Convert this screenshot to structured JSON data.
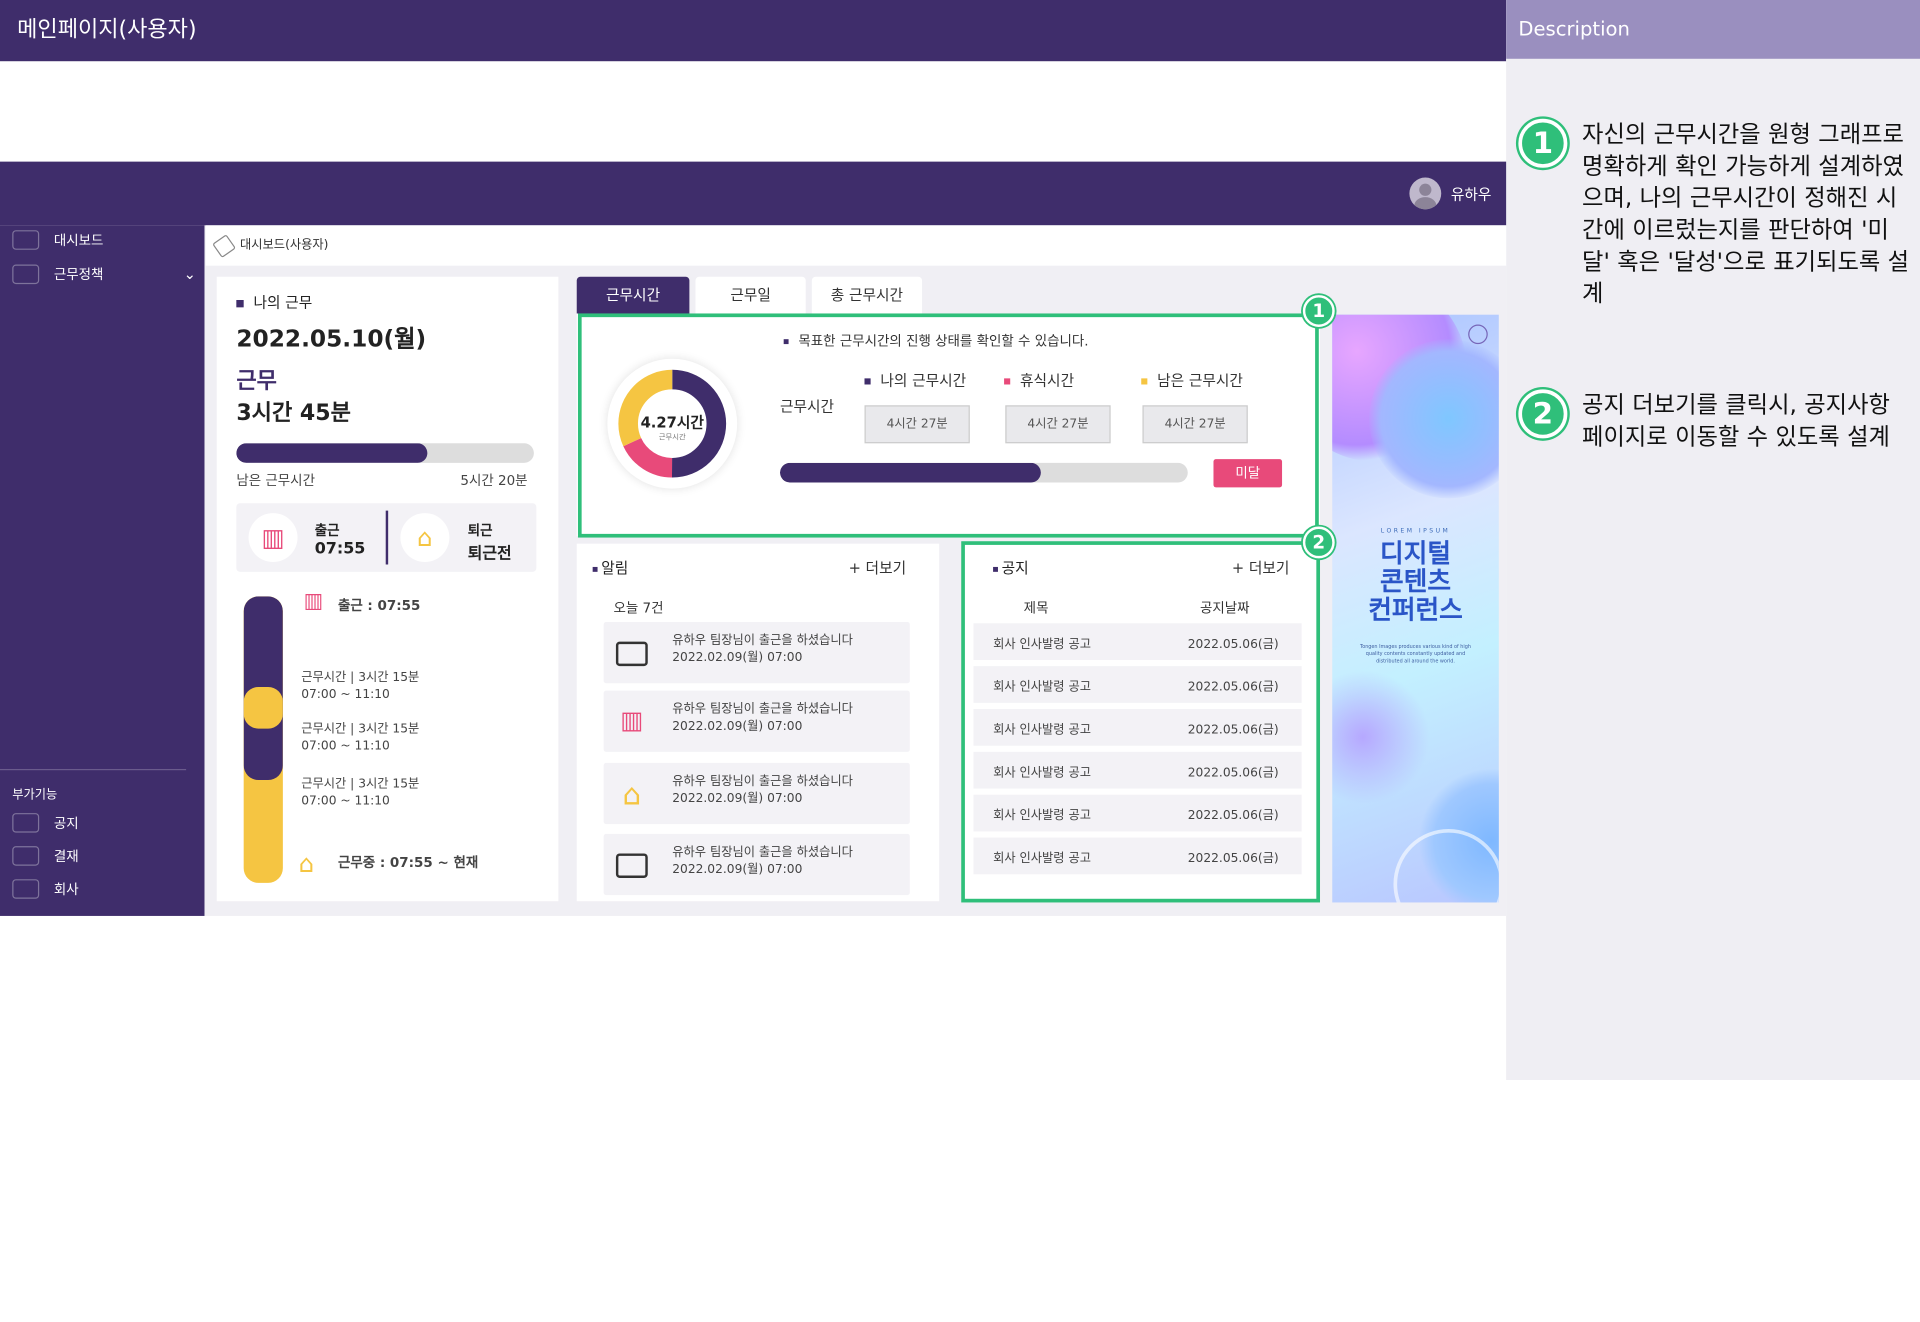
{
  "page_title": "메인페이지(사용자)",
  "description": {
    "heading": "Description",
    "items": [
      {
        "num": "1",
        "text": "자신의 근무시간을 원형 그래프로 명확하게 확인 가능하게 설계하였으며, 나의 근무시간이 정해진 시간에 이르렀는지를 판단하여 '미달' 혹은 '달성'으로 표기되도록 설계"
      },
      {
        "num": "2",
        "text": "공지 더보기를 클릭시, 공지사항 페이지로 이동할 수 있도록 설계"
      }
    ]
  },
  "header": {
    "user_name": "유하우"
  },
  "sidebar": {
    "items": [
      {
        "label": "대시보드",
        "icon": "pencil-icon"
      },
      {
        "label": "근무정책",
        "icon": "chart-icon",
        "chevron": "⌄"
      }
    ],
    "sub_heading": "부가기능",
    "sub_items": [
      {
        "label": "공지",
        "icon": "megaphone-icon"
      },
      {
        "label": "결재",
        "icon": "clipboard-icon"
      },
      {
        "label": "회사",
        "icon": "building-icon"
      }
    ]
  },
  "breadcrumb": "대시보드(사용자)",
  "my_work": {
    "heading": "나의 근무",
    "date": "2022.05.10(월)",
    "status": "근무",
    "duration": "3시간 45분",
    "progress": 0.64,
    "remaining_label": "남은 근무시간",
    "remaining_value": "5시간 20분",
    "checkin_label": "출근",
    "checkin_time": "07:55",
    "checkout_label": "퇴근",
    "checkout_value": "퇴근전",
    "timeline": {
      "start": "출근 : 07:55",
      "entries": [
        {
          "title": "근무시간 | 3시간 15분",
          "range": "07:00 ~ 11:10"
        },
        {
          "title": "근무시간 | 3시간 15분",
          "range": "07:00 ~ 11:10"
        },
        {
          "title": "근무시간 | 3시간 15분",
          "range": "07:00 ~ 11:10"
        }
      ],
      "current": "근무중 : 07:55 ~ 현재"
    }
  },
  "tabs": [
    {
      "label": "근무시간",
      "active": true
    },
    {
      "label": "근무일",
      "active": false
    },
    {
      "label": "총 근무시간",
      "active": false
    }
  ],
  "work_time": {
    "note": "목표한 근무시간의 진행 상태를 확인할 수 있습니다.",
    "donut_value": "4.27시간",
    "donut_caption": "근무시간",
    "donut_segments": [
      {
        "name": "나의 근무시간",
        "fraction": 0.5,
        "color": "#3f2d6b"
      },
      {
        "name": "휴식시간",
        "fraction": 0.18,
        "color": "#e84a7a"
      },
      {
        "name": "남은 근무시간",
        "fraction": 0.32,
        "color": "#f5c542"
      }
    ],
    "row_label": "근무시간",
    "legend": [
      {
        "label": "나의 근무시간",
        "color": "#3f2d6b",
        "value": "4시간 27분"
      },
      {
        "label": "휴식시간",
        "color": "#e84a7a",
        "value": "4시간 27분"
      },
      {
        "label": "남은 근무시간",
        "color": "#f5c542",
        "value": "4시간 27분"
      }
    ],
    "progress": 0.64,
    "status_badge": "미달"
  },
  "alerts": {
    "heading": "알림",
    "more": "+ 더보기",
    "count_label": "오늘 7건",
    "items": [
      {
        "icon": "briefcase-icon",
        "glyph": "💼",
        "text": "유하우 팀장님이 출근을 하셨습니다",
        "time": "2022.02.09(월) 07:00"
      },
      {
        "icon": "building-icon",
        "glyph": "🏢",
        "text": "유하우 팀장님이 출근을 하셨습니다",
        "time": "2022.02.09(월) 07:00"
      },
      {
        "icon": "home-icon",
        "glyph": "⌂",
        "text": "유하우 팀장님이 출근을 하셨습니다",
        "time": "2022.02.09(월) 07:00"
      },
      {
        "icon": "briefcase-icon",
        "glyph": "💼",
        "text": "유하우 팀장님이 출근을 하셨습니다",
        "time": "2022.02.09(월) 07:00"
      }
    ]
  },
  "notices": {
    "heading": "공지",
    "more": "+ 더보기",
    "col_title": "제목",
    "col_date": "공지날짜",
    "rows": [
      {
        "title": "회사 인사발령 공고",
        "date": "2022.05.06(금)"
      },
      {
        "title": "회사 인사발령 공고",
        "date": "2022.05.06(금)"
      },
      {
        "title": "회사 인사발령 공고",
        "date": "2022.05.06(금)"
      },
      {
        "title": "회사 인사발령 공고",
        "date": "2022.05.06(금)"
      },
      {
        "title": "회사 인사발령 공고",
        "date": "2022.05.06(금)"
      },
      {
        "title": "회사 인사발령 공고",
        "date": "2022.05.06(금)"
      }
    ]
  },
  "banner": {
    "kicker": "LOREM IPSUM",
    "title_lines": [
      "디지털",
      "콘텐츠",
      "컨퍼런스"
    ],
    "body": "Tongen Images produces various kind of high quality contents constantly updated and distributed all around the world."
  },
  "annotations": [
    "1",
    "2"
  ]
}
